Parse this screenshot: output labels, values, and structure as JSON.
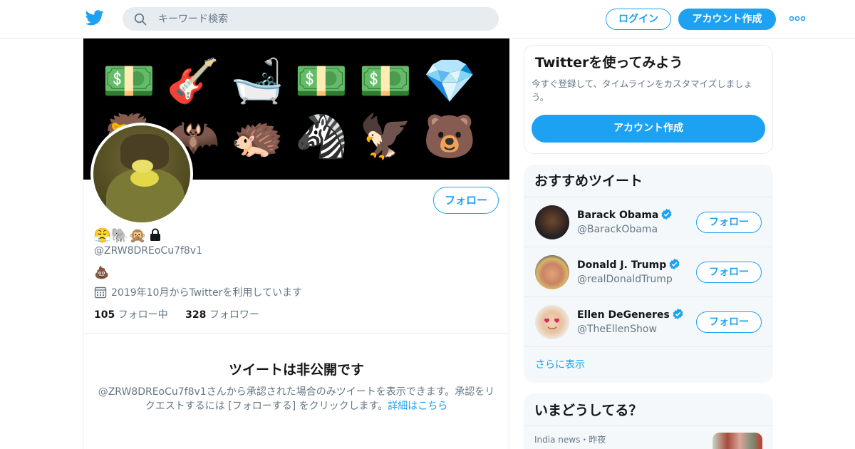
{
  "header": {
    "search_placeholder": "キーワード検索",
    "login_label": "ログイン",
    "signup_label": "アカウント作成",
    "brand_color": "#1da1f2"
  },
  "profile": {
    "banner_emojis": [
      "💵",
      "🎸",
      "🛁",
      "💵",
      "💵",
      "💎",
      "🦁",
      "🦇",
      "🦔",
      "🦓",
      "🦅",
      "🐻"
    ],
    "display_name_emojis": "😤🐘🙊",
    "protected_icon": "lock-icon",
    "handle": "@ZRW8DREoCu7f8v1",
    "bio": "💩",
    "joined": "2019年10月からTwitterを利用しています",
    "follow_label": "フォロー",
    "following_count": "105",
    "following_label": "フォロー中",
    "followers_count": "328",
    "followers_label": "フォロワー",
    "protected_title": "ツイートは非公開です",
    "protected_desc": "@ZRW8DREoCu7f8v1さんから承認された場合のみツイートを表示できます。承認をリクエストするには [フォローする] をクリックします。",
    "protected_link": "詳細はこちら"
  },
  "signup_card": {
    "title": "Twitterを使ってみよう",
    "desc": "今すぐ登録して、タイムラインをカスタマイズしましょう。",
    "cta": "アカウント作成"
  },
  "recommended": {
    "title": "おすすめツイート",
    "users": [
      {
        "name": "Barack Obama",
        "handle": "@BarackObama",
        "follow": "フォロー"
      },
      {
        "name": "Donald J. Trump",
        "handle": "@realDonaldTrump",
        "follow": "フォロー"
      },
      {
        "name": "Ellen DeGeneres",
        "handle": "@TheEllenShow",
        "follow": "フォロー"
      }
    ],
    "show_more": "さらに表示"
  },
  "trends": {
    "title": "いまどうしてる？",
    "item_meta": "India news・昨夜"
  }
}
